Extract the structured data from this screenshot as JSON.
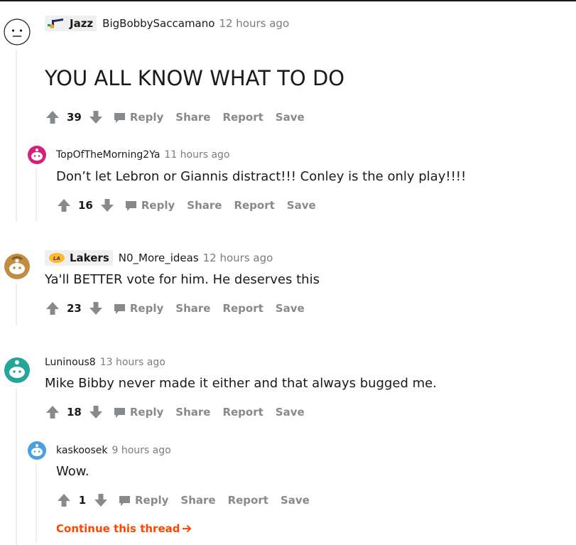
{
  "comments": [
    {
      "flair": {
        "label": "Jazz",
        "icon": "jazz-note-logo"
      },
      "username": "BigBobbySaccamano",
      "time": "12 hours ago",
      "body": "YOU ALL KNOW WHAT TO DO",
      "score": "39",
      "actions": {
        "reply": "Reply",
        "share": "Share",
        "report": "Report",
        "save": "Save"
      }
    },
    {
      "username": "TopOfTheMorning2Ya",
      "time": "11 hours ago",
      "body": "Don’t let Lebron or Giannis distract!!! Conley is the only play!!!!",
      "score": "16",
      "actions": {
        "reply": "Reply",
        "share": "Share",
        "report": "Report",
        "save": "Save"
      }
    },
    {
      "flair": {
        "label": "Lakers",
        "icon": "lakers-logo"
      },
      "username": "N0_More_ideas",
      "time": "12 hours ago",
      "body": "Ya'll BETTER vote for him. He deserves this",
      "score": "23",
      "actions": {
        "reply": "Reply",
        "share": "Share",
        "report": "Report",
        "save": "Save"
      }
    },
    {
      "username": "Luninous8",
      "time": "13 hours ago",
      "body": "Mike Bibby never made it either and that always bugged me.",
      "score": "18",
      "actions": {
        "reply": "Reply",
        "share": "Share",
        "report": "Report",
        "save": "Save"
      }
    },
    {
      "username": "kaskoosek",
      "time": "9 hours ago",
      "body": "Wow.",
      "score": "1",
      "actions": {
        "reply": "Reply",
        "share": "Share",
        "report": "Report",
        "save": "Save"
      }
    }
  ],
  "continue_thread": "Continue this thread",
  "colors": {
    "accent": "#ff4500",
    "muted": "#878a8c",
    "text": "#1a1a1b",
    "thread_line": "#edeff1"
  }
}
